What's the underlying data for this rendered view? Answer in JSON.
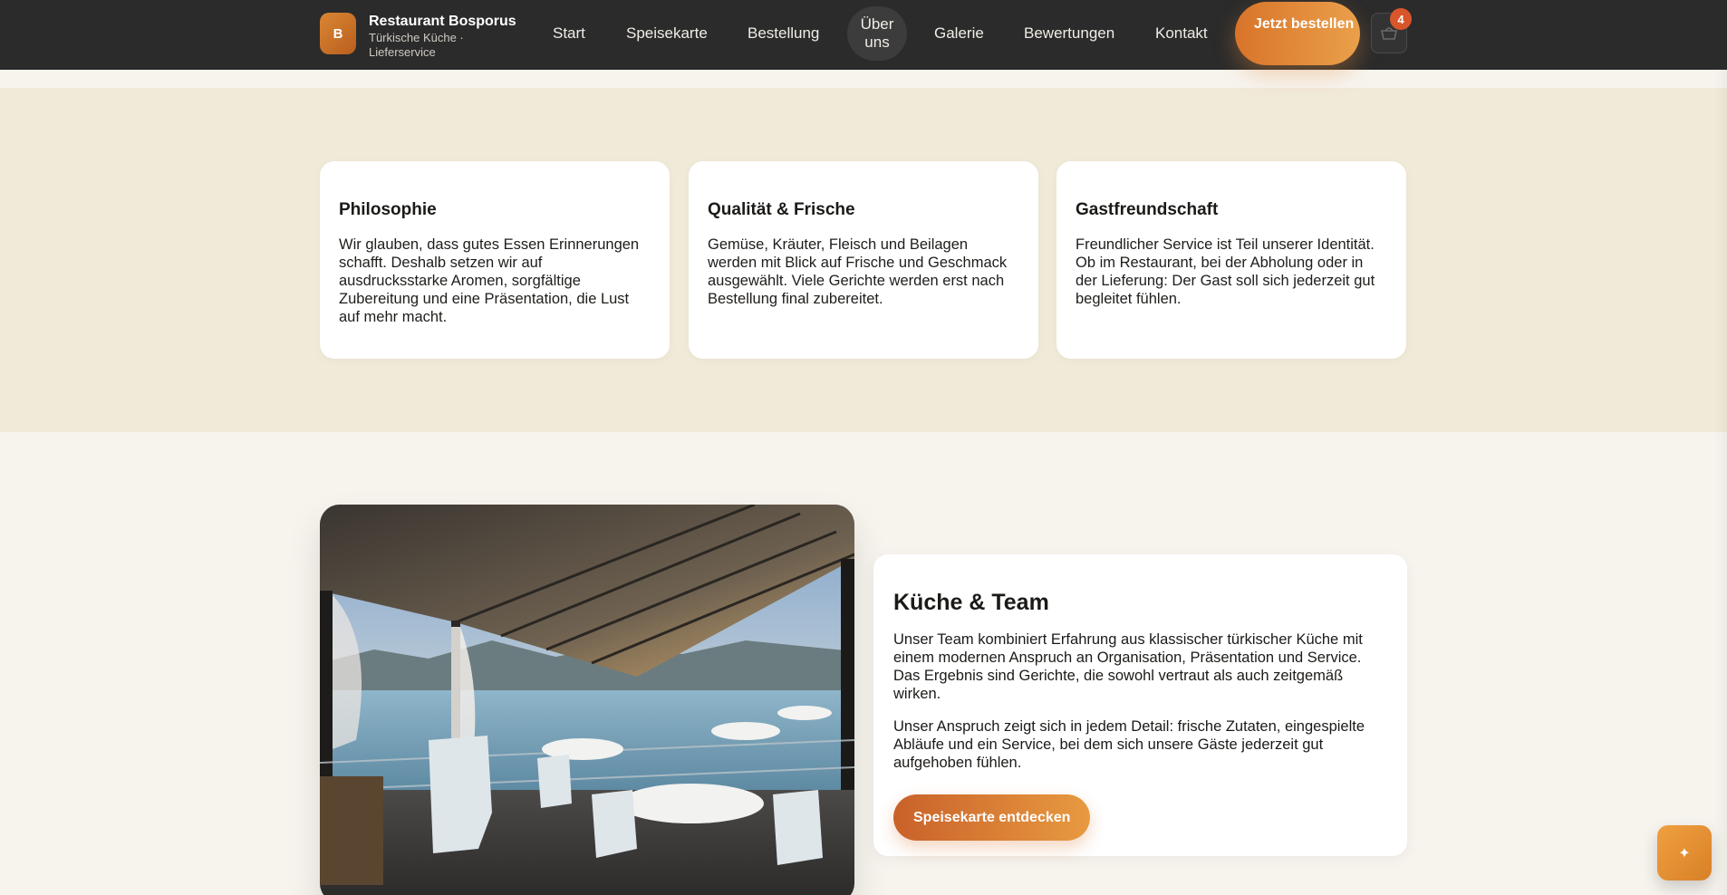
{
  "header": {
    "logo_letter": "B",
    "name": "Restaurant Bosporus",
    "subtitle": "Türkische Küche · Lieferservice",
    "nav": [
      {
        "label": "Start"
      },
      {
        "label": "Speisekarte"
      },
      {
        "label": "Bestellung"
      },
      {
        "label": "Über uns",
        "active": true
      },
      {
        "label": "Galerie"
      },
      {
        "label": "Bewertungen"
      },
      {
        "label": "Kontakt"
      }
    ],
    "cta_label": "Jetzt bestellen",
    "cart_count": "4"
  },
  "values": [
    {
      "title": "Philosophie",
      "text": "Wir glauben, dass gutes Essen Erinnerungen schafft. Deshalb setzen wir auf ausdrucksstarke Aromen, sorgfältige Zubereitung und eine Präsentation, die Lust auf mehr macht."
    },
    {
      "title": "Qualität & Frische",
      "text": "Gemüse, Kräuter, Fleisch und Beilagen werden mit Blick auf Frische und Geschmack ausgewählt. Viele Gerichte werden erst nach Bestellung final zubereitet."
    },
    {
      "title": "Gastfreundschaft",
      "text": "Freundlicher Service ist Teil unserer Identität. Ob im Restaurant, bei der Abholung oder in der Lieferung: Der Gast soll sich jederzeit gut begleitet fühlen."
    }
  ],
  "team": {
    "title": "Küche & Team",
    "paragraph_1": "Unser Team kombiniert Erfahrung aus klassischer türkischer Küche mit einem modernen Anspruch an Organisation, Präsentation und Service. Das Ergebnis sind Gerichte, die sowohl vertraut als auch zeitgemäß wirken.",
    "paragraph_2": "Unser Anspruch zeigt sich in jedem Detail: frische Zutaten, eingespielte Abläufe und ein Service, bei dem sich unsere Gäste jederzeit gut aufgehoben fühlen.",
    "button_label": "Speisekarte entdecken"
  },
  "fab": {
    "icon": "sparkle-icon"
  },
  "colors": {
    "accent": "#e08a38",
    "header_bg": "#2b2b2b",
    "section_bg": "#f1ead9"
  }
}
